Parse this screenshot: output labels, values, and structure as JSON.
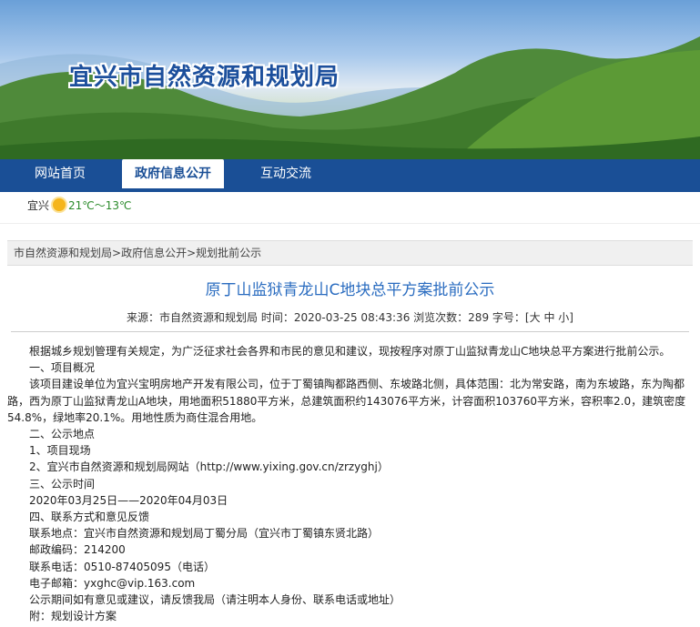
{
  "site": {
    "title": "宜兴市自然资源和规划局"
  },
  "nav": {
    "items": [
      "网站首页",
      "政府信息公开",
      "互动交流"
    ]
  },
  "weather": {
    "city": "宜兴",
    "temp": "21℃～13℃",
    "icon": "sun-cloud-icon"
  },
  "breadcrumb": {
    "parts": [
      "市自然资源和规划局",
      ">",
      "政府信息公开",
      ">",
      "规划批前公示"
    ]
  },
  "article": {
    "title": "原丁山监狱青龙山C地块总平方案批前公示",
    "meta": {
      "source_label": "来源：",
      "source": "市自然资源和规划局",
      "time_label": "时间：",
      "time": "2020-03-25 08:43:36",
      "views_label": "浏览次数：",
      "views": "289",
      "font_label": "字号：[",
      "font_sizes": [
        "大",
        "中",
        "小"
      ],
      "font_close": "]"
    },
    "paragraphs": [
      "根据城乡规划管理有关规定，为广泛征求社会各界和市民的意见和建议，现按程序对原丁山监狱青龙山C地块总平方案进行批前公示。",
      "一、项目概况",
      "该项目建设单位为宜兴宝明房地产开发有限公司，位于丁蜀镇陶都路西侧、东坡路北侧，具体范围：北为常安路，南为东坡路，东为陶都路，西为原丁山监狱青龙山A地块，用地面积51880平方米，总建筑面积约143076平方米，计容面积103760平方米，容积率2.0，建筑密度54.8%，绿地率20.1%。用地性质为商住混合用地。",
      "二、公示地点",
      "1、项目现场",
      "2、宜兴市自然资源和规划局网站（http://www.yixing.gov.cn/zrzyghj）",
      "三、公示时间",
      "2020年03月25日——2020年04月03日",
      "四、联系方式和意见反馈",
      "联系地点：宜兴市自然资源和规划局丁蜀分局（宜兴市丁蜀镇东贤北路）",
      "邮政编码：214200",
      "联系电话：0510-87405095（电话）",
      "电子邮箱：yxghc@vip.163.com",
      "公示期间如有意见或建议，请反馈我局（请注明本人身份、联系电话或地址）",
      "附：规划设计方案"
    ]
  },
  "colors": {
    "nav_bg": "#1a4f96",
    "title_blue": "#2a6cc0",
    "site_title": "#1c4f9c"
  }
}
